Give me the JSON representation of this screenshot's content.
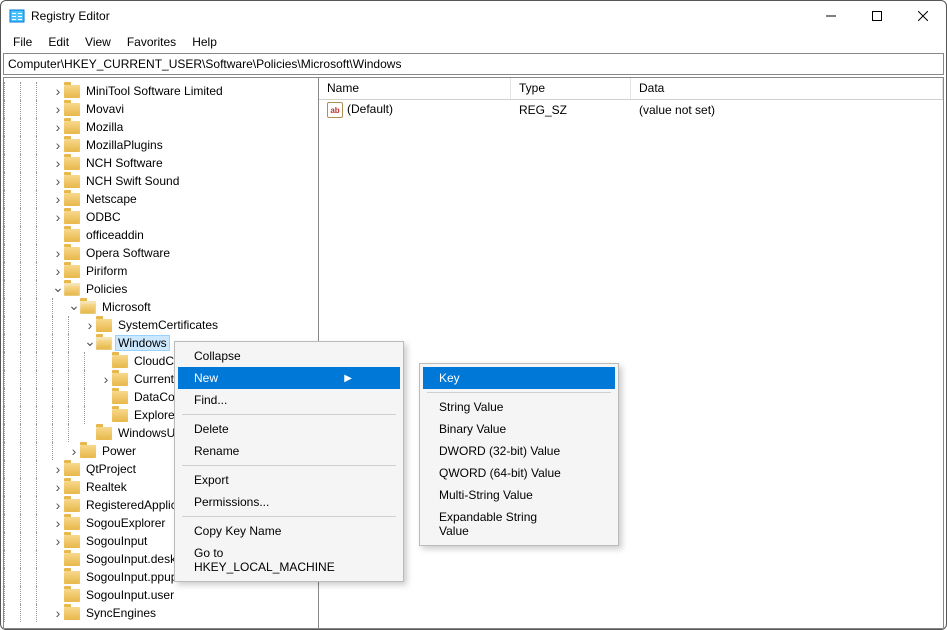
{
  "window": {
    "title": "Registry Editor"
  },
  "menubar": [
    "File",
    "Edit",
    "View",
    "Favorites",
    "Help"
  ],
  "address": "Computer\\HKEY_CURRENT_USER\\Software\\Policies\\Microsoft\\Windows",
  "tree": [
    {
      "level": 3,
      "chev": ">",
      "label": "MiniTool Software Limited"
    },
    {
      "level": 3,
      "chev": ">",
      "label": "Movavi"
    },
    {
      "level": 3,
      "chev": ">",
      "label": "Mozilla"
    },
    {
      "level": 3,
      "chev": ">",
      "label": "MozillaPlugins"
    },
    {
      "level": 3,
      "chev": ">",
      "label": "NCH Software"
    },
    {
      "level": 3,
      "chev": ">",
      "label": "NCH Swift Sound"
    },
    {
      "level": 3,
      "chev": ">",
      "label": "Netscape"
    },
    {
      "level": 3,
      "chev": ">",
      "label": "ODBC"
    },
    {
      "level": 3,
      "chev": "",
      "label": "officeaddin"
    },
    {
      "level": 3,
      "chev": ">",
      "label": "Opera Software"
    },
    {
      "level": 3,
      "chev": ">",
      "label": "Piriform"
    },
    {
      "level": 3,
      "chev": "v",
      "label": "Policies",
      "open": true
    },
    {
      "level": 4,
      "chev": "v",
      "label": "Microsoft",
      "open": true
    },
    {
      "level": 5,
      "chev": ">",
      "label": "SystemCertificates"
    },
    {
      "level": 5,
      "chev": "v",
      "label": "Windows",
      "selected": true,
      "open": true
    },
    {
      "level": 6,
      "chev": "",
      "label": "CloudContent"
    },
    {
      "level": 6,
      "chev": ">",
      "label": "CurrentVersion"
    },
    {
      "level": 6,
      "chev": "",
      "label": "DataCollection"
    },
    {
      "level": 6,
      "chev": "",
      "label": "Explorer"
    },
    {
      "level": 5,
      "chev": "",
      "label": "WindowsUpdate"
    },
    {
      "level": 4,
      "chev": ">",
      "label": "Power"
    },
    {
      "level": 3,
      "chev": ">",
      "label": "QtProject"
    },
    {
      "level": 3,
      "chev": ">",
      "label": "Realtek"
    },
    {
      "level": 3,
      "chev": ">",
      "label": "RegisteredApplications"
    },
    {
      "level": 3,
      "chev": ">",
      "label": "SogouExplorer"
    },
    {
      "level": 3,
      "chev": ">",
      "label": "SogouInput"
    },
    {
      "level": 3,
      "chev": "",
      "label": "SogouInput.deskbar.user"
    },
    {
      "level": 3,
      "chev": "",
      "label": "SogouInput.ppup.user"
    },
    {
      "level": 3,
      "chev": "",
      "label": "SogouInput.user"
    },
    {
      "level": 3,
      "chev": ">",
      "label": "SyncEngines"
    }
  ],
  "list": {
    "headers": {
      "name": "Name",
      "type": "Type",
      "data": "Data"
    },
    "rows": [
      {
        "icon": "ab",
        "name": "(Default)",
        "type": "REG_SZ",
        "data": "(value not set)"
      }
    ]
  },
  "context_menu": {
    "collapse": "Collapse",
    "new": "New",
    "find": "Find...",
    "delete": "Delete",
    "rename": "Rename",
    "export": "Export",
    "permissions": "Permissions...",
    "copy_key_name": "Copy Key Name",
    "goto_hklm": "Go to HKEY_LOCAL_MACHINE"
  },
  "new_submenu": {
    "key": "Key",
    "string": "String Value",
    "binary": "Binary Value",
    "dword": "DWORD (32-bit) Value",
    "qword": "QWORD (64-bit) Value",
    "multi": "Multi-String Value",
    "expand": "Expandable String Value"
  }
}
